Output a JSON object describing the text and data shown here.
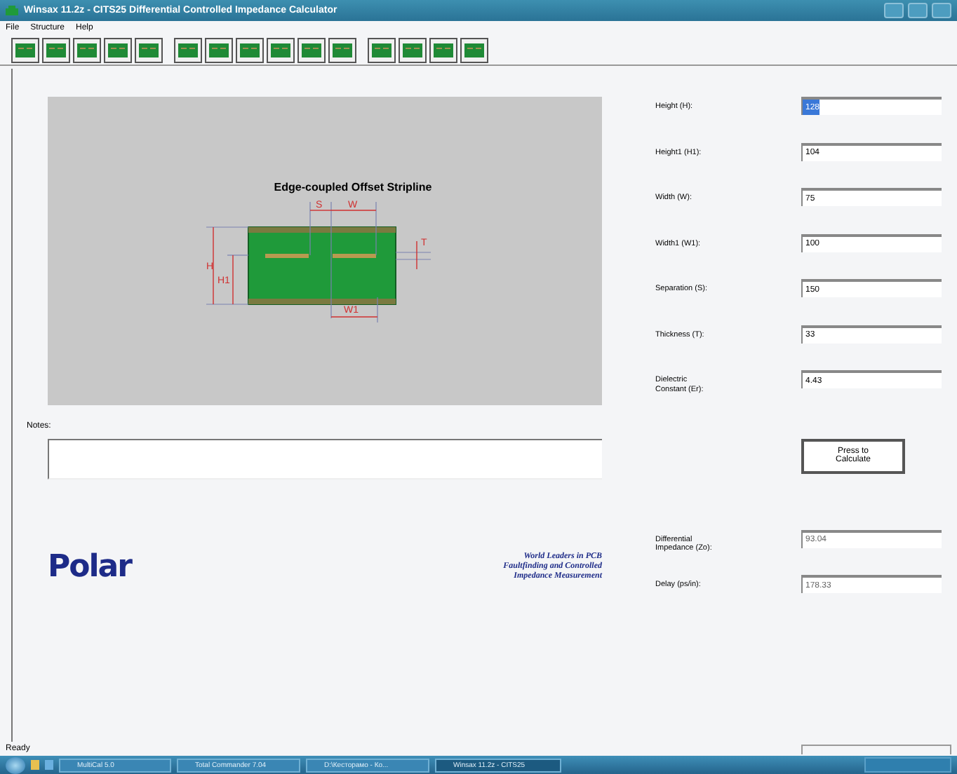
{
  "window": {
    "title": "Winsax 11.2z - CITS25 Differential Controlled Impedance Calculator"
  },
  "menu": [
    "File",
    "Structure",
    "Help"
  ],
  "diagram": {
    "title": "Edge-coupled Offset Stripline",
    "labels": [
      "S",
      "W",
      "T",
      "H",
      "H1",
      "W1"
    ]
  },
  "notes": {
    "label": "Notes:"
  },
  "logo": {
    "text": "Polar",
    "tagline": [
      "World Leaders in PCB",
      "Faultfinding and Controlled",
      "Impedance Measurement"
    ]
  },
  "inputs": [
    {
      "label": "Height (H):",
      "value": "128",
      "highlighted": true
    },
    {
      "label": "Height1 (H1):",
      "value": "104",
      "highlighted": false
    },
    {
      "label": "Width (W):",
      "value": "75",
      "highlighted": false
    },
    {
      "label": "Width1 (W1):",
      "value": "100",
      "highlighted": false
    },
    {
      "label": "Separation (S):",
      "value": "150",
      "highlighted": false
    },
    {
      "label": "Thickness (T):",
      "value": "33",
      "highlighted": false
    },
    {
      "label": "Dielectric\nConstant (Er):",
      "value": "4.43",
      "highlighted": false
    }
  ],
  "calculate_button": "Press to\nCalculate",
  "outputs": [
    {
      "label": "Differential\nImpedance (Zo):",
      "value": "93.04"
    },
    {
      "label": "Delay (ps/in):",
      "value": "178.33"
    }
  ],
  "status_bar": {
    "text": "Ready"
  },
  "taskbar": {
    "tasks": [
      {
        "label": "MultiCal 5.0",
        "active": false
      },
      {
        "label": "Total Commander 7.04",
        "active": false
      },
      {
        "label": "D:\\Кесторамо - Ко...",
        "active": false
      },
      {
        "label": "Winsax 11.2z - CITS25",
        "active": true
      }
    ]
  }
}
